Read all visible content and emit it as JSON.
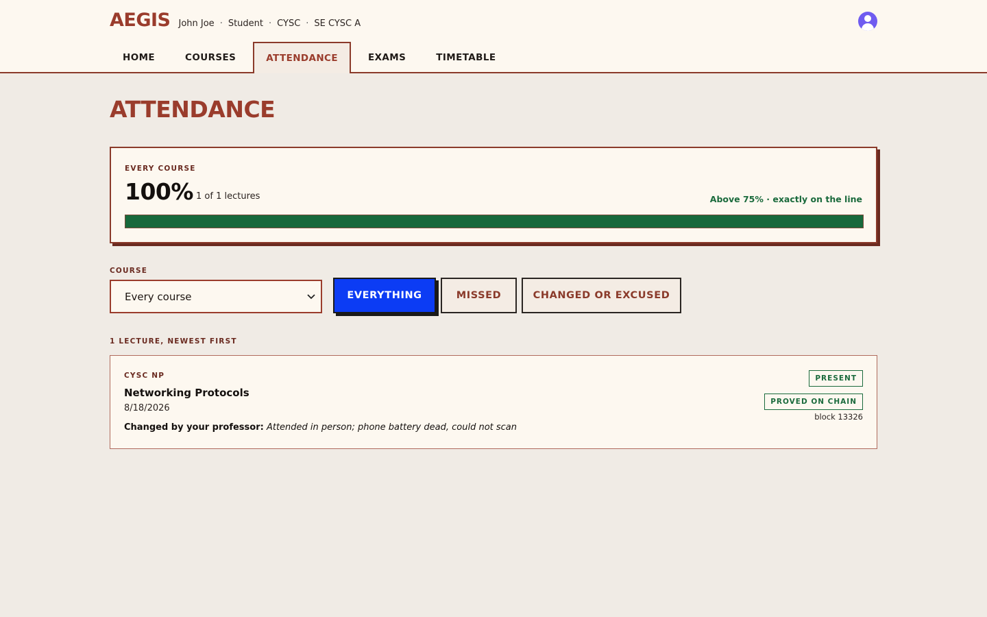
{
  "app": {
    "brand": "AEGIS",
    "user_name": "John Joe",
    "role": "Student",
    "department": "CYSC",
    "section": "SE CYSC A",
    "separator": "·"
  },
  "nav": {
    "items": [
      {
        "label": "HOME",
        "active": false
      },
      {
        "label": "COURSES",
        "active": false
      },
      {
        "label": "ATTENDANCE",
        "active": true
      },
      {
        "label": "EXAMS",
        "active": false
      },
      {
        "label": "TIMETABLE",
        "active": false
      }
    ]
  },
  "page": {
    "title": "ATTENDANCE"
  },
  "summary": {
    "label": "EVERY COURSE",
    "percent": "100%",
    "lectures_text": "1 of 1 lectures",
    "status_text": "Above 75% · exactly on the line",
    "progress_fraction": 1.0
  },
  "filters": {
    "course_label": "COURSE",
    "course_selected": "Every course",
    "buttons": [
      {
        "label": "EVERYTHING",
        "active": true
      },
      {
        "label": "MISSED",
        "active": false
      },
      {
        "label": "CHANGED OR EXCUSED",
        "active": false
      }
    ]
  },
  "list": {
    "heading": "1 LECTURE, NEWEST FIRST",
    "items": [
      {
        "code": "CYSC NP",
        "name": "Networking Protocols",
        "date": "8/18/2026",
        "note_lead": "Changed by your professor:",
        "note_reason": "Attended in person; phone battery dead, could not scan",
        "status_badge": "PRESENT",
        "chain_badge": "PROVED ON CHAIN",
        "block": "block 13326"
      }
    ]
  },
  "colors": {
    "brand": "#9a3c2c",
    "accent_button": "#0c3cf4",
    "success": "#17693c",
    "header_bg": "#fdf8f0",
    "page_bg": "#f0ebe5"
  },
  "icons": {
    "avatar": "user-avatar-icon",
    "select_arrow": "chevron-down-icon"
  }
}
